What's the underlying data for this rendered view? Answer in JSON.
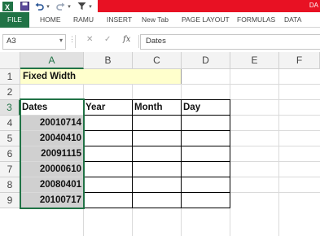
{
  "app": {
    "title_fragment": "DA",
    "accent_green": "#217346",
    "title_red": "#e81123"
  },
  "qat": {
    "icons": [
      "excel-logo-icon",
      "save-icon",
      "undo-icon",
      "redo-icon",
      "filter-icon"
    ]
  },
  "ribbon": {
    "tabs": [
      "FILE",
      "HOME",
      "RAMU",
      "INSERT",
      "New Tab",
      "PAGE LAYOUT",
      "FORMULAS",
      "DATA"
    ]
  },
  "formula_bar": {
    "name_box": "A3",
    "formula": "Dates"
  },
  "grid": {
    "columns": [
      "A",
      "B",
      "C",
      "D",
      "E",
      "F"
    ],
    "selected_column": "A",
    "rows": [
      "1",
      "2",
      "3",
      "4",
      "5",
      "6",
      "7",
      "8",
      "9"
    ],
    "selected_row": "3",
    "title_cell": "Fixed Width",
    "title_fill": "#ffffcc",
    "date_fill": "#d0d0d0",
    "headers": [
      "Dates",
      "Year",
      "Month",
      "Day"
    ],
    "dates": [
      "20010714",
      "20040410",
      "20091115",
      "20000610",
      "20080401",
      "20100717"
    ]
  }
}
